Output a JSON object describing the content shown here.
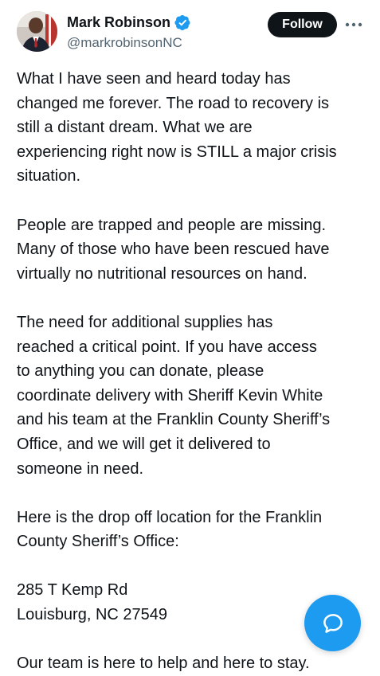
{
  "author": {
    "display_name": "Mark Robinson",
    "handle": "@markrobinsonNC",
    "verified": true,
    "avatar_icon": "profile-photo"
  },
  "actions": {
    "follow_label": "Follow",
    "more_icon": "more-dots-icon"
  },
  "tweet": {
    "paragraphs": [
      [
        "What I have seen and heard today has",
        "changed me forever. The road to recovery is",
        "still a distant dream. What we are",
        "experiencing right now is STILL a major crisis",
        "situation."
      ],
      [
        "People are trapped and people are missing.",
        "Many of those who have been rescued have",
        "virtually no nutritional resources on hand."
      ],
      [
        "The need for additional supplies has",
        "reached a critical point. If you have access",
        "to anything you can donate, please",
        "coordinate delivery with Sheriff Kevin White",
        "and his team at the Franklin County Sheriff’s",
        "Office, and we will get it delivered to",
        "someone in need."
      ],
      [
        "Here is the drop off location for the Franklin",
        "County Sheriff’s Office:"
      ],
      [
        "285 T Kemp Rd",
        "Louisburg, NC 27549"
      ],
      [
        "Our team is here to help and here to stay."
      ]
    ]
  },
  "fab": {
    "icon": "reply-bubble-icon"
  },
  "colors": {
    "accent": "#1d9bf0",
    "text": "#0f1419",
    "secondary_text": "#536471",
    "follow_bg": "#0f1419"
  }
}
